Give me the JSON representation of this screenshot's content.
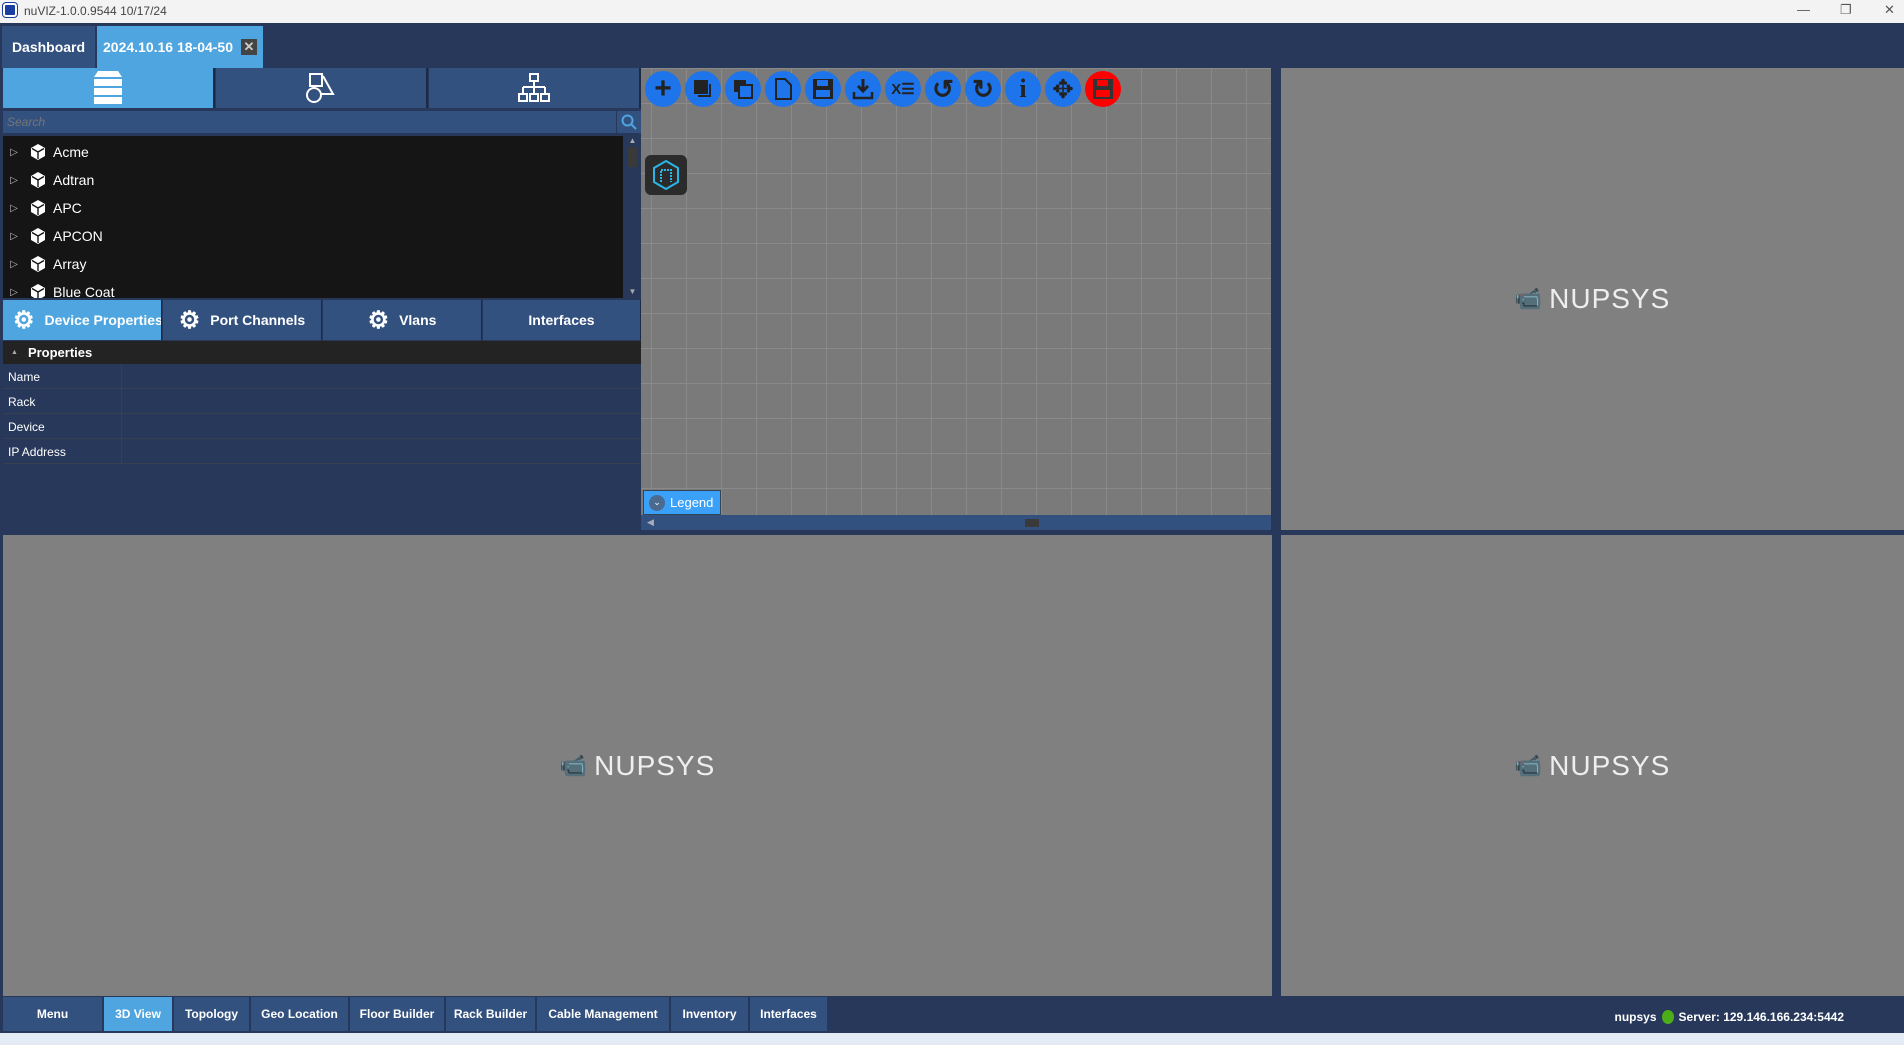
{
  "window": {
    "title": "nuVIZ-1.0.0.9544 10/17/24"
  },
  "doc_tabs": [
    {
      "label": "Dashboard"
    },
    {
      "label": "2024.10.16 18-04-50",
      "active": true
    }
  ],
  "left_panel": {
    "icon_tabs": [
      "devices-icon",
      "shapes-icon",
      "hierarchy-icon"
    ],
    "search": {
      "placeholder": "Search",
      "value": ""
    },
    "tree": [
      "Acme",
      "Adtran",
      "APC",
      "APCON",
      "Array",
      "Blue Coat"
    ],
    "prop_tabs": [
      "Device Properties",
      "Port Channels",
      "Vlans",
      "Interfaces"
    ],
    "properties": {
      "header": "Properties",
      "rows": [
        "Name",
        "Rack",
        "Device",
        "IP Address"
      ]
    }
  },
  "canvas": {
    "toolbar": [
      "add-icon",
      "copy-icon",
      "duplicate-icon",
      "new-file-icon",
      "save-icon",
      "download-icon",
      "excel-icon",
      "undo-icon",
      "redo-icon",
      "info-icon",
      "move-icon",
      "save-red-icon"
    ],
    "legend_label": "Legend"
  },
  "views": {
    "logo_text": "nupsys"
  },
  "bottom_bar": {
    "items": [
      "Menu",
      "3D View",
      "Topology",
      "Geo Location",
      "Floor Builder",
      "Rack Builder",
      "Cable Management",
      "Inventory",
      "Interfaces"
    ],
    "active": "3D View",
    "user": "nupsys",
    "server": "Server: 129.146.166.234:5442",
    "status_color": "#4caf1a"
  },
  "colors": {
    "accent": "#4ea5e0",
    "panel": "#33517f",
    "bg": "#27385a",
    "toolbar_btn": "#1e74ea"
  }
}
